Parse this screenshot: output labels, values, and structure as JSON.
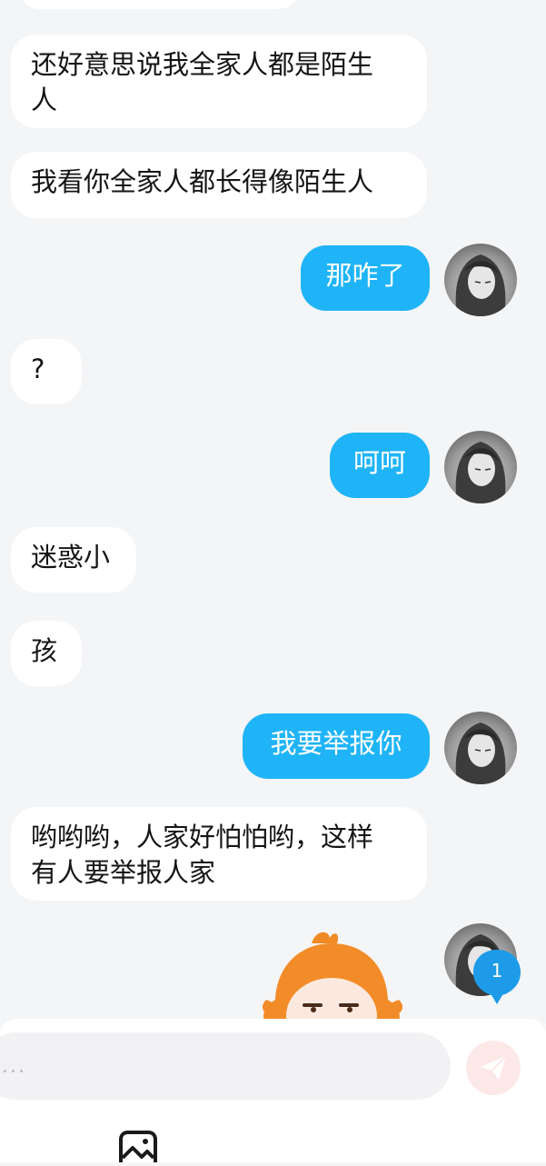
{
  "messages": [
    {
      "side": "in",
      "text_lines": [
        "还好意思说我全家人都是陌生",
        "人"
      ]
    },
    {
      "side": "in",
      "text_lines": [
        "我看你全家人都长得像陌生人"
      ]
    },
    {
      "side": "out",
      "text_lines": [
        "那咋了"
      ]
    },
    {
      "side": "in",
      "text_lines": [
        "?"
      ]
    },
    {
      "side": "out",
      "text_lines": [
        "呵呵"
      ]
    },
    {
      "side": "in",
      "text_lines": [
        "迷惑小"
      ]
    },
    {
      "side": "in",
      "text_lines": [
        "孩"
      ]
    },
    {
      "side": "out",
      "text_lines": [
        "我要举报你"
      ]
    },
    {
      "side": "in",
      "text_lines": [
        "哟哟哟，人家好怕怕哟，这样",
        "有人要举报人家"
      ]
    }
  ],
  "sticker": {
    "icon": "orange-haired-girl-sticker"
  },
  "badge": {
    "count": "1",
    "color": "#1e9be8"
  },
  "composer": {
    "placeholder": "...",
    "send_icon": "paper-plane-icon"
  },
  "toolbar": {
    "image_icon": "image-icon"
  },
  "colors": {
    "outgoing_bubble": "#1fb4f7",
    "incoming_bubble": "#ffffff",
    "background": "#f4f5f7"
  }
}
